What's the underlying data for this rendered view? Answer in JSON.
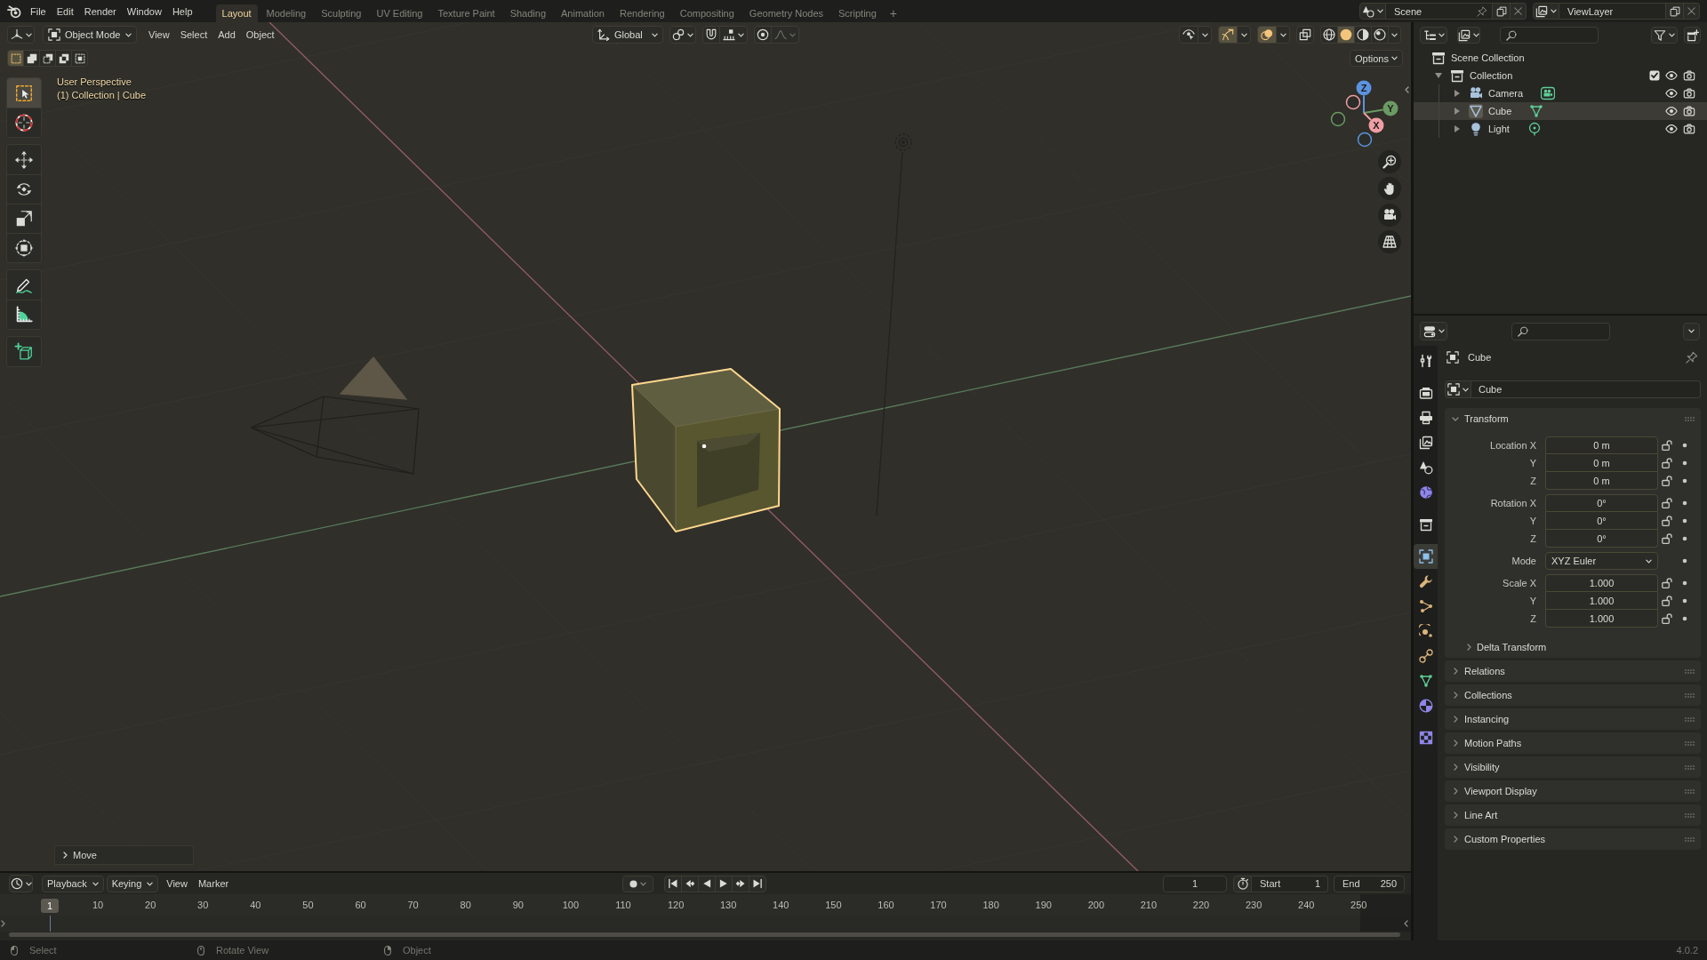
{
  "topbar": {
    "menus": [
      "File",
      "Edit",
      "Render",
      "Window",
      "Help"
    ],
    "workspaces": [
      {
        "label": "Layout",
        "selected": true
      },
      {
        "label": "Modeling",
        "selected": false
      },
      {
        "label": "Sculpting",
        "selected": false
      },
      {
        "label": "UV Editing",
        "selected": false
      },
      {
        "label": "Texture Paint",
        "selected": false
      },
      {
        "label": "Shading",
        "selected": false
      },
      {
        "label": "Animation",
        "selected": false
      },
      {
        "label": "Rendering",
        "selected": false
      },
      {
        "label": "Compositing",
        "selected": false
      },
      {
        "label": "Geometry Nodes",
        "selected": false
      },
      {
        "label": "Scripting",
        "selected": false
      }
    ],
    "add_workspace": "+",
    "scene": "Scene",
    "view_layer": "ViewLayer"
  },
  "viewport": {
    "mode": "Object Mode",
    "menus": [
      "View",
      "Select",
      "Add",
      "Object"
    ],
    "orientation": "Global",
    "header_toggles": [
      {
        "kind": "selectability",
        "on": false
      },
      {
        "kind": "gizmos",
        "on": true
      },
      {
        "kind": "overlays",
        "on": true
      },
      {
        "kind": "xray",
        "on": false
      }
    ],
    "shading_modes": [
      {
        "kind": "wireframe",
        "selected": false
      },
      {
        "kind": "solid",
        "selected": true
      },
      {
        "kind": "material",
        "selected": false
      },
      {
        "kind": "rendered",
        "selected": false
      }
    ],
    "options": "Options",
    "select_modes": [
      {
        "kind": "set",
        "selected": true
      },
      {
        "kind": "extend",
        "selected": false
      },
      {
        "kind": "subtract",
        "selected": false
      },
      {
        "kind": "invert",
        "selected": false
      },
      {
        "kind": "intersect",
        "selected": false
      }
    ],
    "view_name": "User Perspective",
    "context": "(1) Collection | Cube",
    "tool_groups": [
      {
        "tools": [
          {
            "kind": "select_box",
            "selected": true
          },
          {
            "kind": "cursor",
            "selected": false
          }
        ]
      },
      {
        "tools": [
          {
            "kind": "move",
            "selected": false
          },
          {
            "kind": "rotate",
            "selected": false
          },
          {
            "kind": "scale",
            "selected": false
          },
          {
            "kind": "transform",
            "selected": false
          }
        ]
      },
      {
        "tools": [
          {
            "kind": "annotate",
            "selected": false
          },
          {
            "kind": "measure",
            "selected": false
          }
        ]
      },
      {
        "tools": [
          {
            "kind": "add_cube",
            "selected": false
          }
        ]
      }
    ],
    "gizmo_axes": [
      {
        "label": "Z",
        "color": "#5b93e0"
      },
      {
        "label": "Y",
        "color": "#6b9a63"
      },
      {
        "label": "X",
        "color": "#f09ea4"
      }
    ],
    "last_operator": "Move"
  },
  "outliner": {
    "root": "Scene Collection",
    "items": [
      {
        "label": "Collection",
        "kind": "collection",
        "expanded": true,
        "checked": true,
        "selected": false,
        "visible": true,
        "children": [
          {
            "label": "Camera",
            "kind": "camera",
            "expanded": false,
            "selected": false,
            "visible": true
          },
          {
            "label": "Cube",
            "kind": "mesh",
            "expanded": false,
            "selected": true,
            "visible": true
          },
          {
            "label": "Light",
            "kind": "light",
            "expanded": false,
            "selected": false,
            "visible": true
          }
        ]
      }
    ]
  },
  "properties": {
    "tab_groups": [
      {
        "tabs": [
          {
            "kind": "tool",
            "selected": false
          }
        ]
      },
      {
        "tabs": [
          {
            "kind": "render",
            "selected": false
          },
          {
            "kind": "output",
            "selected": false
          },
          {
            "kind": "view_layer",
            "selected": false
          },
          {
            "kind": "scene",
            "selected": false
          },
          {
            "kind": "world",
            "selected": false
          }
        ]
      },
      {
        "tabs": [
          {
            "kind": "collection",
            "selected": false
          }
        ]
      },
      {
        "tabs": [
          {
            "kind": "object",
            "selected": true
          },
          {
            "kind": "modifiers",
            "selected": false
          },
          {
            "kind": "particles",
            "selected": false
          },
          {
            "kind": "physics",
            "selected": false
          },
          {
            "kind": "constraints",
            "selected": false
          },
          {
            "kind": "data",
            "selected": false
          },
          {
            "kind": "material",
            "selected": false
          }
        ]
      },
      {
        "tabs": [
          {
            "kind": "texture",
            "selected": false
          }
        ]
      }
    ],
    "object_name": "Cube",
    "datablock": "Cube",
    "panels": [
      {
        "title": "Transform",
        "expanded": true,
        "field_groups": [
          {
            "fields": [
              {
                "label": "Location X",
                "value": "0 m",
                "kind": "number",
                "locked": false
              },
              {
                "label": "Y",
                "value": "0 m",
                "kind": "number",
                "locked": false
              },
              {
                "label": "Z",
                "value": "0 m",
                "kind": "number",
                "locked": false
              }
            ]
          },
          {
            "fields": [
              {
                "label": "Rotation X",
                "value": "0°",
                "kind": "number",
                "locked": false
              },
              {
                "label": "Y",
                "value": "0°",
                "kind": "number",
                "locked": false
              },
              {
                "label": "Z",
                "value": "0°",
                "kind": "number",
                "locked": false
              }
            ]
          },
          {
            "fields": [
              {
                "label": "Mode",
                "value": "XYZ Euler",
                "kind": "dropdown"
              }
            ]
          },
          {
            "fields": [
              {
                "label": "Scale X",
                "value": "1.000",
                "kind": "number",
                "locked": false
              },
              {
                "label": "Y",
                "value": "1.000",
                "kind": "number",
                "locked": false
              },
              {
                "label": "Z",
                "value": "1.000",
                "kind": "number",
                "locked": false
              }
            ]
          }
        ],
        "subpanels": [
          {
            "title": "Delta Transform",
            "expanded": false
          }
        ]
      },
      {
        "title": "Relations",
        "expanded": false
      },
      {
        "title": "Collections",
        "expanded": false
      },
      {
        "title": "Instancing",
        "expanded": false
      },
      {
        "title": "Motion Paths",
        "expanded": false
      },
      {
        "title": "Visibility",
        "expanded": false
      },
      {
        "title": "Viewport Display",
        "expanded": false
      },
      {
        "title": "Line Art",
        "expanded": false
      },
      {
        "title": "Custom Properties",
        "expanded": false
      }
    ]
  },
  "timeline": {
    "menus": [
      {
        "label": "Playback",
        "kind": "dropdown"
      },
      {
        "label": "Keying",
        "kind": "dropdown"
      },
      {
        "label": "View",
        "kind": "menu"
      },
      {
        "label": "Marker",
        "kind": "menu"
      }
    ],
    "auto_keying": {
      "on": false
    },
    "current_frame": "1",
    "start_label": "Start",
    "start": "1",
    "end_label": "End",
    "end": "250",
    "playhead": "1",
    "ruler": [
      "10",
      "20",
      "30",
      "40",
      "50",
      "60",
      "70",
      "80",
      "90",
      "100",
      "110",
      "120",
      "130",
      "140",
      "150",
      "160",
      "170",
      "180",
      "190",
      "200",
      "210",
      "220",
      "230",
      "240",
      "250"
    ]
  },
  "status_bar": {
    "hints": [
      {
        "kind": "left",
        "label": "Select"
      },
      {
        "kind": "middle",
        "label": "Rotate View"
      },
      {
        "kind": "right",
        "label": "Object"
      }
    ],
    "version": "4.0.2"
  }
}
